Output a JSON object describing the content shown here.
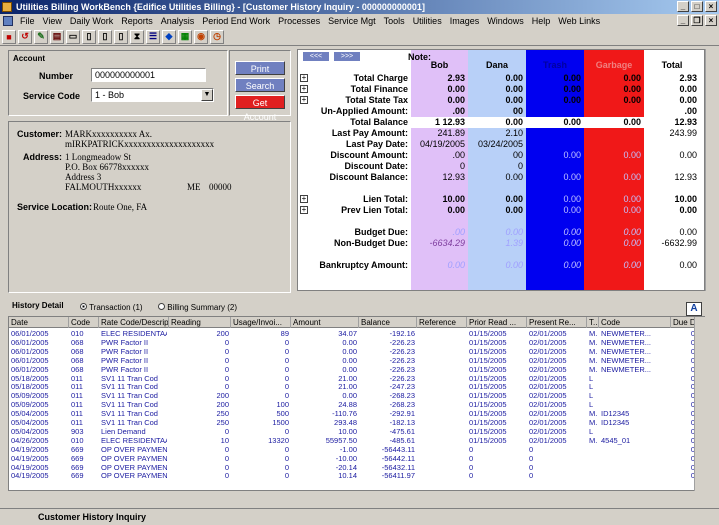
{
  "window": {
    "title": "Utilities Billing WorkBench {Edifice Utilities Billing} - [Customer History Inquiry - 000000000001]"
  },
  "menu": [
    "File",
    "View",
    "Daily Work",
    "Reports",
    "Analysis",
    "Period End Work",
    "Processes",
    "Service Mgt",
    "Tools",
    "Utilities",
    "Images",
    "Windows",
    "Help",
    "Web Links"
  ],
  "account": {
    "group_label": "Account",
    "number_label": "Number",
    "number_value": "000000000001",
    "service_code_label": "Service Code",
    "service_code_value": "1 - Bob",
    "print": "Print",
    "search": "Search",
    "get_account": "Get Account"
  },
  "customer": {
    "label": "Customer:",
    "name": "MARKxxxxxxxxxx Ax. mIRKPATRICKxxxxxxxxxxxxxxxxxxxx",
    "address_label": "Address:",
    "addr1": "1 Longmeadow St",
    "addr2": "P.O. Box 66778xxxxxx",
    "addr3": "Address 3",
    "city": "FALMOUTHxxxxxx",
    "state": "ME",
    "zip": "00000",
    "service_location_label": "Service Location:",
    "service_location": "Route One, FA"
  },
  "nav": {
    "prev": "<<<",
    "next": ">>>"
  },
  "summary": {
    "note_label": "Note:",
    "columns": [
      "Bob",
      "Dana",
      "Trash",
      "Garbage",
      "Total"
    ],
    "rows": [
      {
        "label": "Total Charge",
        "values": [
          "2.93",
          "0.00",
          "0.00",
          "0.00",
          "2.93"
        ],
        "exp": true
      },
      {
        "label": "Total Finance",
        "values": [
          "0.00",
          "0.00",
          "0.00",
          "0.00",
          "0.00"
        ],
        "exp": true
      },
      {
        "label": "Total State Tax",
        "values": [
          "0.00",
          "0.00",
          "0.00",
          "0.00",
          "0.00"
        ],
        "exp": true
      },
      {
        "label": "Un-Applied Amount:",
        "values": [
          ".00",
          "00",
          "",
          "",
          ".00"
        ]
      },
      {
        "label": "Total Balance",
        "values": [
          "1   12.93",
          "0.00",
          "0.00",
          "0.00",
          "12.93"
        ]
      },
      {
        "label": "Last Pay Amount:",
        "values": [
          "241.89",
          "2.10",
          "",
          "",
          "243.99"
        ]
      },
      {
        "label": "Last Pay Date:",
        "values": [
          "04/19/2005",
          "03/24/2005",
          "",
          "",
          ""
        ]
      },
      {
        "label": "Discount Amount:",
        "values": [
          ".00",
          "00",
          "0.00",
          "0.00",
          "0.00"
        ]
      },
      {
        "label": "Discount Date:",
        "values": [
          "0",
          "0",
          "",
          "",
          ""
        ]
      },
      {
        "label": "Discount Balance:",
        "values": [
          "12.93",
          "0.00",
          "0.00",
          "0.00",
          "12.93"
        ]
      },
      {
        "label": "",
        "values": [
          "",
          "",
          "",
          "",
          ""
        ]
      },
      {
        "label": "Lien Total:",
        "values": [
          "10.00",
          "0.00",
          "0.00",
          "0.00",
          "10.00"
        ],
        "exp": true
      },
      {
        "label": "Prev Lien Total:",
        "values": [
          "0.00",
          "0.00",
          "0.00",
          "0.00",
          "0.00"
        ],
        "exp": true
      },
      {
        "label": "",
        "values": [
          "",
          "",
          "",
          "",
          ""
        ]
      },
      {
        "label": "Budget Due:",
        "values": [
          ".00",
          "0.00",
          "0.00",
          "0.00",
          "0.00"
        ]
      },
      {
        "label": "Non-Budget Due:",
        "values": [
          "-6634.29",
          "1.39",
          "0.00",
          "0.00",
          "-6632.99"
        ]
      },
      {
        "label": "",
        "values": [
          "",
          "",
          "",
          "",
          ""
        ]
      },
      {
        "label": "Bankruptcy Amount:",
        "values": [
          "0.00",
          "0.00",
          "0.00",
          "0.00",
          "0.00"
        ]
      }
    ]
  },
  "history": {
    "label": "History Detail",
    "radio_transaction": "Transaction (1)",
    "radio_billing": "Billing Summary (2)",
    "columns": [
      "Date",
      "Code",
      "Rate Code/Descripti...",
      "Reading",
      "Usage/Invoi...",
      "Amount",
      "Balance",
      "Reference",
      "Prior Read ...",
      "Present Re...",
      "T..",
      "Code",
      "Due Date"
    ],
    "rows": [
      [
        "06/01/2005",
        "010",
        "ELEC RESIDENTAA",
        "200",
        "89",
        "34.07",
        "-192.16",
        "",
        "01/15/2005",
        "02/01/2005",
        "M..",
        "NEWMETER...",
        "0"
      ],
      [
        "06/01/2005",
        "068",
        "PWR Factor II",
        "0",
        "0",
        "0.00",
        "-226.23",
        "",
        "01/15/2005",
        "02/01/2005",
        "M..",
        "NEWMETER...",
        "0"
      ],
      [
        "06/01/2005",
        "068",
        "PWR Factor II",
        "0",
        "0",
        "0.00",
        "-226.23",
        "",
        "01/15/2005",
        "02/01/2005",
        "M..",
        "NEWMETER...",
        "0"
      ],
      [
        "06/01/2005",
        "068",
        "PWR Factor II",
        "0",
        "0",
        "0.00",
        "-226.23",
        "",
        "01/15/2005",
        "02/01/2005",
        "M..",
        "NEWMETER...",
        "0"
      ],
      [
        "06/01/2005",
        "068",
        "PWR Factor II",
        "0",
        "0",
        "0.00",
        "-226.23",
        "",
        "01/15/2005",
        "02/01/2005",
        "M..",
        "NEWMETER...",
        "0"
      ],
      [
        "05/18/2005",
        "011",
        "SV1  11 Tran Cod",
        "0",
        "0",
        "21.00",
        "-226.23",
        "",
        "01/15/2005",
        "02/01/2005",
        "L",
        "",
        "0"
      ],
      [
        "05/18/2005",
        "011",
        "SV1  11 Tran Cod",
        "0",
        "0",
        "21.00",
        "-247.23",
        "",
        "01/15/2005",
        "02/01/2005",
        "L",
        "",
        "0"
      ],
      [
        "05/09/2005",
        "011",
        "SV1  11 Tran Cod",
        "200",
        "0",
        "0.00",
        "-268.23",
        "",
        "01/15/2005",
        "02/01/2005",
        "L",
        "",
        "0"
      ],
      [
        "05/09/2005",
        "011",
        "SV1  11 Tran Cod",
        "200",
        "100",
        "24.88",
        "-268.23",
        "",
        "01/15/2005",
        "02/01/2005",
        "L",
        "",
        "0"
      ],
      [
        "05/04/2005",
        "011",
        "SV1  11 Tran Cod",
        "250",
        "500",
        "-110.76",
        "-292.91",
        "",
        "01/15/2005",
        "02/01/2005",
        "M..",
        "ID12345",
        "0"
      ],
      [
        "05/04/2005",
        "011",
        "SV1  11 Tran Cod",
        "250",
        "1500",
        "293.48",
        "-182.13",
        "",
        "01/15/2005",
        "02/01/2005",
        "M..",
        "ID12345",
        "0"
      ],
      [
        "05/04/2005",
        "903",
        "Lien Demand",
        "0",
        "0",
        "10.00",
        "-475.61",
        "",
        "01/15/2005",
        "02/01/2005",
        "L",
        "",
        "0"
      ],
      [
        "04/26/2005",
        "010",
        "ELEC RESIDENTAA",
        "10",
        "13320",
        "55957.50",
        "-485.61",
        "",
        "01/15/2005",
        "02/01/2005",
        "M..",
        "4545_01",
        "0"
      ],
      [
        "04/19/2005",
        "669",
        "OP   OVER PAYMEN",
        "0",
        "0",
        "-1.00",
        "-56443.11",
        "",
        "0",
        "0",
        "",
        "",
        "0"
      ],
      [
        "04/19/2005",
        "669",
        "OP   OVER PAYMEN",
        "0",
        "0",
        "-10.00",
        "-56442.11",
        "",
        "0",
        "0",
        "",
        "",
        "0"
      ],
      [
        "04/19/2005",
        "669",
        "OP   OVER PAYMEN",
        "0",
        "0",
        "-20.14",
        "-56432.11",
        "",
        "0",
        "0",
        "",
        "",
        "0"
      ],
      [
        "04/19/2005",
        "669",
        "OP   OVER PAYMEN",
        "0",
        "0",
        "10.14",
        "-56411.97",
        "",
        "0",
        "0",
        "",
        "",
        "0"
      ]
    ]
  },
  "status": {
    "text": "Customer History Inquiry"
  },
  "colors": {
    "bob": "#e0c0f8",
    "dana": "#b8d0f8",
    "trash": "#0000f0",
    "garbage": "#f01818"
  }
}
